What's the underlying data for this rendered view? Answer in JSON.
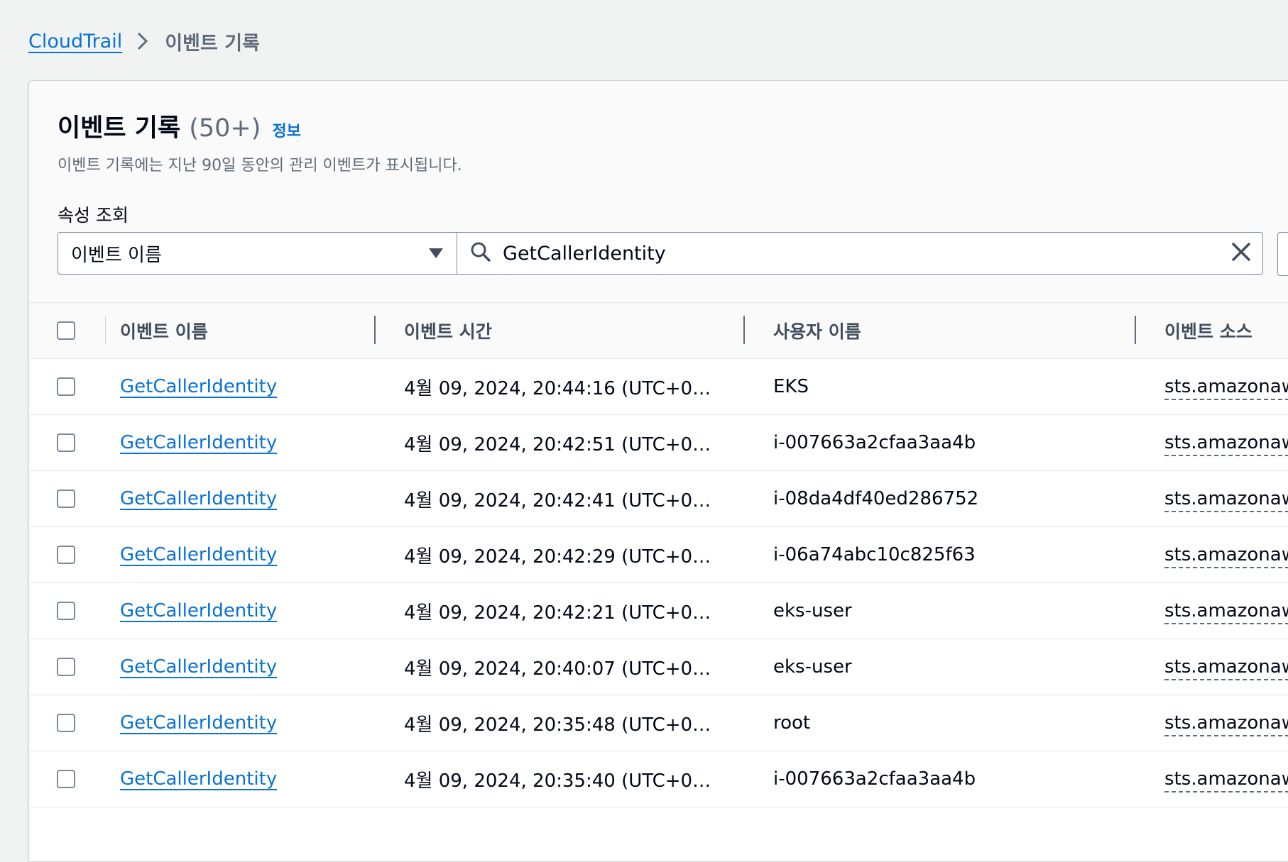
{
  "breadcrumb": {
    "root": "CloudTrail",
    "current": "이벤트 기록"
  },
  "header": {
    "title": "이벤트 기록",
    "count": "(50+)",
    "info": "정보",
    "description": "이벤트 기록에는 지난 90일 동안의 관리 이벤트가 표시됩니다."
  },
  "filter": {
    "label": "속성 조회",
    "property": "이벤트 이름",
    "value": "GetCallerIdentity"
  },
  "table": {
    "columns": [
      "이벤트 이름",
      "이벤트 시간",
      "사용자 이름",
      "이벤트 소스"
    ],
    "rows": [
      {
        "event_name": "GetCallerIdentity",
        "event_time": "4월 09, 2024, 20:44:16 (UTC+09:…",
        "user_name": "EKS",
        "event_source": "sts.amazonaw"
      },
      {
        "event_name": "GetCallerIdentity",
        "event_time": "4월 09, 2024, 20:42:51 (UTC+09:…",
        "user_name": "i-007663a2cfaa3aa4b",
        "event_source": "sts.amazonaw"
      },
      {
        "event_name": "GetCallerIdentity",
        "event_time": "4월 09, 2024, 20:42:41 (UTC+09:…",
        "user_name": "i-08da4df40ed286752",
        "event_source": "sts.amazonaw"
      },
      {
        "event_name": "GetCallerIdentity",
        "event_time": "4월 09, 2024, 20:42:29 (UTC+09:…",
        "user_name": "i-06a74abc10c825f63",
        "event_source": "sts.amazonaw"
      },
      {
        "event_name": "GetCallerIdentity",
        "event_time": "4월 09, 2024, 20:42:21 (UTC+09:…",
        "user_name": "eks-user",
        "event_source": "sts.amazonaw"
      },
      {
        "event_name": "GetCallerIdentity",
        "event_time": "4월 09, 2024, 20:40:07 (UTC+09:…",
        "user_name": "eks-user",
        "event_source": "sts.amazonaw"
      },
      {
        "event_name": "GetCallerIdentity",
        "event_time": "4월 09, 2024, 20:35:48 (UTC+09:…",
        "user_name": "root",
        "event_source": "sts.amazonaw"
      },
      {
        "event_name": "GetCallerIdentity",
        "event_time": "4월 09, 2024, 20:35:40 (UTC+09:…",
        "user_name": "i-007663a2cfaa3aa4b",
        "event_source": "sts.amazonaw"
      }
    ]
  },
  "icons": {
    "breadcrumb_separator": "chevron-right-icon",
    "dropdown": "caret-down-icon",
    "search": "search-icon",
    "clear": "close-icon"
  },
  "colors": {
    "link": "#0972d3",
    "text": "#000716",
    "muted": "#5f6b7a",
    "page_bg": "#f1f3f3"
  }
}
